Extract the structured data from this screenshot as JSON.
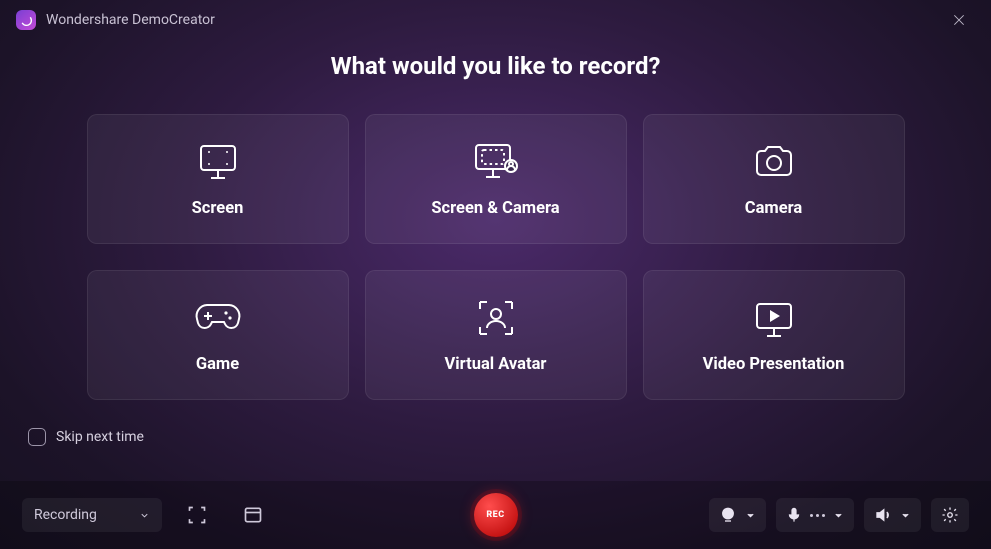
{
  "app": {
    "title": "Wondershare DemoCreator"
  },
  "heading": "What would you like to record?",
  "cards": [
    {
      "label": "Screen"
    },
    {
      "label": "Screen & Camera"
    },
    {
      "label": "Camera"
    },
    {
      "label": "Game"
    },
    {
      "label": "Virtual Avatar"
    },
    {
      "label": "Video Presentation"
    }
  ],
  "skip": {
    "label": "Skip next time",
    "checked": false
  },
  "toolbar": {
    "mode_label": "Recording",
    "rec_label": "REC"
  }
}
